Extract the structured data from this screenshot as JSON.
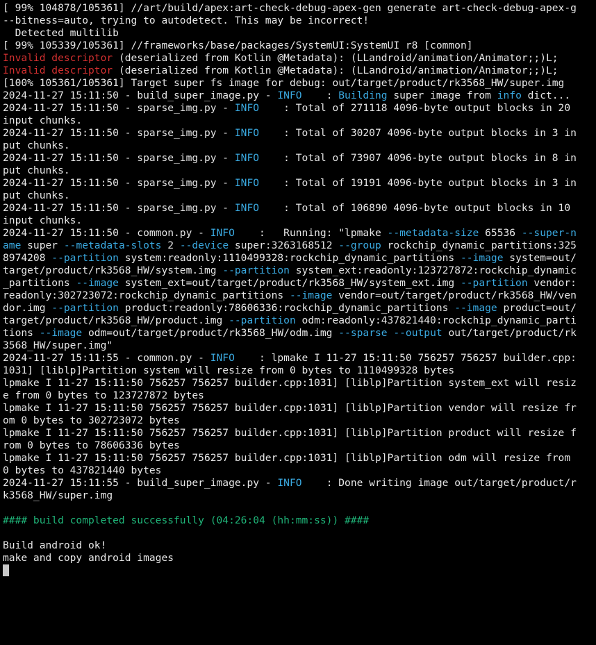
{
  "terminal": {
    "lines": [
      [
        {
          "t": "[ 99% 104878/105361] //art/build/apex:art-check-debug-apex-gen generate art-check-debug-apex-g",
          "c": "plain"
        }
      ],
      [
        {
          "t": "--bitness=auto, trying to autodetect. This may be incorrect!",
          "c": "plain"
        }
      ],
      [
        {
          "t": "  Detected multilib",
          "c": "plain"
        }
      ],
      [
        {
          "t": "[ 99% 105339/105361] //frameworks/base/packages/SystemUI:SystemUI r8 [common]",
          "c": "plain"
        }
      ],
      [
        {
          "t": "Invalid descriptor",
          "c": "red"
        },
        {
          "t": " (deserialized from Kotlin @Metadata): (LLandroid/animation/Animator;;)L;",
          "c": "plain"
        }
      ],
      [
        {
          "t": "Invalid descriptor",
          "c": "red"
        },
        {
          "t": " (deserialized from Kotlin @Metadata): (LLandroid/animation/Animator;;)L;",
          "c": "plain"
        }
      ],
      [
        {
          "t": "[100% 105361/105361] Target super fs image for debug: out/target/product/rk3568_HW/super.img",
          "c": "plain"
        }
      ],
      [
        {
          "t": "2024-11-27 15:11:50 - build_super_image.py - ",
          "c": "plain"
        },
        {
          "t": "INFO",
          "c": "cyan"
        },
        {
          "t": "    : ",
          "c": "plain"
        },
        {
          "t": "Building",
          "c": "cyan"
        },
        {
          "t": " super image from ",
          "c": "plain"
        },
        {
          "t": "info",
          "c": "cyan"
        },
        {
          "t": " dict...",
          "c": "plain"
        }
      ],
      [
        {
          "t": "2024-11-27 15:11:50 - sparse_img.py - ",
          "c": "plain"
        },
        {
          "t": "INFO",
          "c": "cyan"
        },
        {
          "t": "    : Total of 271118 4096-byte output blocks in 20",
          "c": "plain"
        }
      ],
      [
        {
          "t": "input chunks.",
          "c": "plain"
        }
      ],
      [
        {
          "t": "2024-11-27 15:11:50 - sparse_img.py - ",
          "c": "plain"
        },
        {
          "t": "INFO",
          "c": "cyan"
        },
        {
          "t": "    : Total of 30207 4096-byte output blocks in 3 in",
          "c": "plain"
        }
      ],
      [
        {
          "t": "put chunks.",
          "c": "plain"
        }
      ],
      [
        {
          "t": "2024-11-27 15:11:50 - sparse_img.py - ",
          "c": "plain"
        },
        {
          "t": "INFO",
          "c": "cyan"
        },
        {
          "t": "    : Total of 73907 4096-byte output blocks in 8 in",
          "c": "plain"
        }
      ],
      [
        {
          "t": "put chunks.",
          "c": "plain"
        }
      ],
      [
        {
          "t": "2024-11-27 15:11:50 - sparse_img.py - ",
          "c": "plain"
        },
        {
          "t": "INFO",
          "c": "cyan"
        },
        {
          "t": "    : Total of 19191 4096-byte output blocks in 3 in",
          "c": "plain"
        }
      ],
      [
        {
          "t": "put chunks.",
          "c": "plain"
        }
      ],
      [
        {
          "t": "2024-11-27 15:11:50 - sparse_img.py - ",
          "c": "plain"
        },
        {
          "t": "INFO",
          "c": "cyan"
        },
        {
          "t": "    : Total of 106890 4096-byte output blocks in 10",
          "c": "plain"
        }
      ],
      [
        {
          "t": "input chunks.",
          "c": "plain"
        }
      ],
      [
        {
          "t": "2024-11-27 15:11:50 - common.py - ",
          "c": "plain"
        },
        {
          "t": "INFO",
          "c": "cyan"
        },
        {
          "t": "    :   Running: \"lpmake ",
          "c": "plain"
        },
        {
          "t": "--metadata-size",
          "c": "cyan"
        },
        {
          "t": " 65536 ",
          "c": "plain"
        },
        {
          "t": "--super-n",
          "c": "cyan"
        }
      ],
      [
        {
          "t": "ame",
          "c": "cyan"
        },
        {
          "t": " super ",
          "c": "plain"
        },
        {
          "t": "--metadata-slots",
          "c": "cyan"
        },
        {
          "t": " 2 ",
          "c": "plain"
        },
        {
          "t": "--device",
          "c": "cyan"
        },
        {
          "t": " super:3263168512 ",
          "c": "plain"
        },
        {
          "t": "--group",
          "c": "cyan"
        },
        {
          "t": " rockchip_dynamic_partitions:325",
          "c": "plain"
        }
      ],
      [
        {
          "t": "8974208 ",
          "c": "plain"
        },
        {
          "t": "--partition",
          "c": "cyan"
        },
        {
          "t": " system:readonly:1110499328:rockchip_dynamic_partitions ",
          "c": "plain"
        },
        {
          "t": "--image",
          "c": "cyan"
        },
        {
          "t": " system=out/",
          "c": "plain"
        }
      ],
      [
        {
          "t": "target/product/rk3568_HW/system.img ",
          "c": "plain"
        },
        {
          "t": "--partition",
          "c": "cyan"
        },
        {
          "t": " system_ext:readonly:123727872:rockchip_dynamic",
          "c": "plain"
        }
      ],
      [
        {
          "t": "_partitions ",
          "c": "plain"
        },
        {
          "t": "--image",
          "c": "cyan"
        },
        {
          "t": " system_ext=out/target/product/rk3568_HW/system_ext.img ",
          "c": "plain"
        },
        {
          "t": "--partition",
          "c": "cyan"
        },
        {
          "t": " vendor:",
          "c": "plain"
        }
      ],
      [
        {
          "t": "readonly:302723072:rockchip_dynamic_partitions ",
          "c": "plain"
        },
        {
          "t": "--image",
          "c": "cyan"
        },
        {
          "t": " vendor=out/target/product/rk3568_HW/ven",
          "c": "plain"
        }
      ],
      [
        {
          "t": "dor.img ",
          "c": "plain"
        },
        {
          "t": "--partition",
          "c": "cyan"
        },
        {
          "t": " product:readonly:78606336:rockchip_dynamic_partitions ",
          "c": "plain"
        },
        {
          "t": "--image",
          "c": "cyan"
        },
        {
          "t": " product=out/",
          "c": "plain"
        }
      ],
      [
        {
          "t": "target/product/rk3568_HW/product.img ",
          "c": "plain"
        },
        {
          "t": "--partition",
          "c": "cyan"
        },
        {
          "t": " odm:readonly:437821440:rockchip_dynamic_parti",
          "c": "plain"
        }
      ],
      [
        {
          "t": "tions ",
          "c": "plain"
        },
        {
          "t": "--image",
          "c": "cyan"
        },
        {
          "t": " odm=out/target/product/rk3568_HW/odm.img ",
          "c": "plain"
        },
        {
          "t": "--sparse",
          "c": "cyan"
        },
        {
          "t": " ",
          "c": "plain"
        },
        {
          "t": "--output",
          "c": "cyan"
        },
        {
          "t": " out/target/product/rk",
          "c": "plain"
        }
      ],
      [
        {
          "t": "3568_HW/super.img\"",
          "c": "plain"
        }
      ],
      [
        {
          "t": "2024-11-27 15:11:55 - common.py - ",
          "c": "plain"
        },
        {
          "t": "INFO",
          "c": "cyan"
        },
        {
          "t": "    : lpmake I 11-27 15:11:50 756257 756257 builder.cpp:",
          "c": "plain"
        }
      ],
      [
        {
          "t": "1031] [liblp]Partition system will resize from 0 bytes to 1110499328 bytes",
          "c": "plain"
        }
      ],
      [
        {
          "t": "lpmake I 11-27 15:11:50 756257 756257 builder.cpp:1031] [liblp]Partition system_ext will resiz",
          "c": "plain"
        }
      ],
      [
        {
          "t": "e from 0 bytes to 123727872 bytes",
          "c": "plain"
        }
      ],
      [
        {
          "t": "lpmake I 11-27 15:11:50 756257 756257 builder.cpp:1031] [liblp]Partition vendor will resize fr",
          "c": "plain"
        }
      ],
      [
        {
          "t": "om 0 bytes to 302723072 bytes",
          "c": "plain"
        }
      ],
      [
        {
          "t": "lpmake I 11-27 15:11:50 756257 756257 builder.cpp:1031] [liblp]Partition product will resize f",
          "c": "plain"
        }
      ],
      [
        {
          "t": "rom 0 bytes to 78606336 bytes",
          "c": "plain"
        }
      ],
      [
        {
          "t": "lpmake I 11-27 15:11:50 756257 756257 builder.cpp:1031] [liblp]Partition odm will resize from",
          "c": "plain"
        }
      ],
      [
        {
          "t": "0 bytes to 437821440 bytes",
          "c": "plain"
        }
      ],
      [
        {
          "t": "2024-11-27 15:11:55 - build_super_image.py - ",
          "c": "plain"
        },
        {
          "t": "INFO",
          "c": "cyan"
        },
        {
          "t": "    : Done writing image out/target/product/r",
          "c": "plain"
        }
      ],
      [
        {
          "t": "k3568_HW/super.img",
          "c": "plain"
        }
      ],
      [],
      [
        {
          "t": "#### build completed successfully (04:26:04 (hh:mm:ss)) ####",
          "c": "green"
        }
      ],
      [],
      [
        {
          "t": "Build android ok!",
          "c": "plain"
        }
      ],
      [
        {
          "t": "make and copy android images",
          "c": "plain"
        }
      ]
    ]
  },
  "colors": {
    "background": "#000000",
    "text": "#e6e6e6",
    "error": "#d23030",
    "info": "#3aa9e0",
    "success": "#1fb579",
    "cursor": "#c8c8c8"
  }
}
